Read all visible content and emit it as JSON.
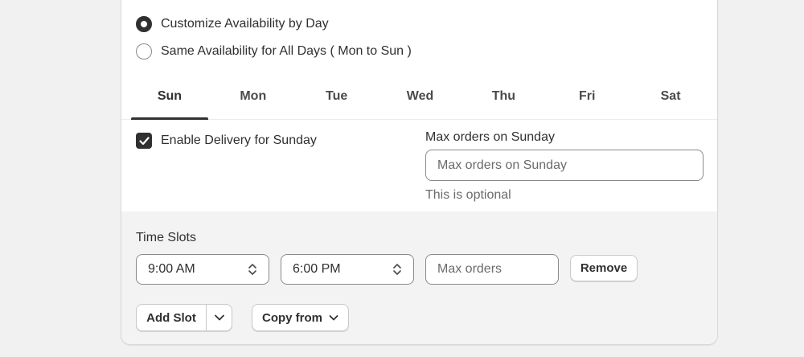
{
  "availability": {
    "options": [
      {
        "label": "Customize Availability by Day",
        "selected": true
      },
      {
        "label": "Same Availability for All Days ( Mon to Sun )",
        "selected": false
      }
    ]
  },
  "tabs": [
    {
      "label": "Sun",
      "active": true
    },
    {
      "label": "Mon",
      "active": false
    },
    {
      "label": "Tue",
      "active": false
    },
    {
      "label": "Wed",
      "active": false
    },
    {
      "label": "Thu",
      "active": false
    },
    {
      "label": "Fri",
      "active": false
    },
    {
      "label": "Sat",
      "active": false
    }
  ],
  "day": {
    "enable_label": "Enable Delivery for Sunday",
    "enable_checked": true,
    "max_orders_label": "Max orders on Sunday",
    "max_orders_placeholder": "Max orders on Sunday",
    "max_orders_help": "This is optional"
  },
  "time_slots": {
    "title": "Time Slots",
    "slots": [
      {
        "start": "9:00 AM",
        "end": "6:00 PM",
        "max_orders_placeholder": "Max orders",
        "remove_label": "Remove"
      }
    ],
    "add_slot_label": "Add Slot",
    "copy_from_label": "Copy from"
  },
  "icons": {
    "checkbox": "checkmark-icon",
    "select": "select-updown-icon",
    "dropdown": "chevron-down-icon"
  }
}
